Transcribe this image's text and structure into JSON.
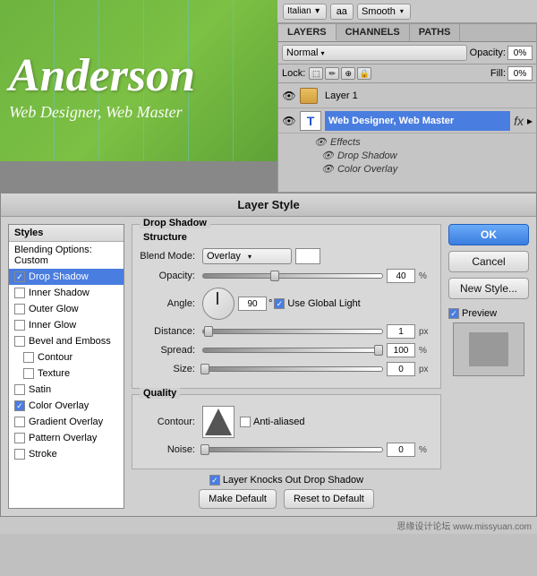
{
  "toolbar": {
    "font_name": "Italian",
    "aa_label": "aa",
    "smooth_label": "Smooth"
  },
  "layers_panel": {
    "tabs": [
      "LAYERS",
      "CHANNELS",
      "PATHS"
    ],
    "active_tab": "LAYERS",
    "blend_mode": "Normal",
    "opacity_label": "Opacity:",
    "opacity_value": "0%",
    "lock_label": "Lock:",
    "fill_label": "Fill:",
    "fill_value": "0%",
    "layer1_name": "Layer 1",
    "layer2_name": "Web Designer, Web Master",
    "effects_label": "Effects",
    "effect1": "Drop Shadow",
    "effect2": "Color Overlay"
  },
  "dialog": {
    "title": "Layer Style",
    "styles_header": "Styles",
    "style_items": [
      {
        "label": "Blending Options: Custom",
        "checked": false,
        "active": false
      },
      {
        "label": "Drop Shadow",
        "checked": true,
        "active": true
      },
      {
        "label": "Inner Shadow",
        "checked": false,
        "active": false
      },
      {
        "label": "Outer Glow",
        "checked": false,
        "active": false
      },
      {
        "label": "Inner Glow",
        "checked": false,
        "active": false
      },
      {
        "label": "Bevel and Emboss",
        "checked": false,
        "active": false
      },
      {
        "label": "Contour",
        "checked": false,
        "active": false,
        "indented": true
      },
      {
        "label": "Texture",
        "checked": false,
        "active": false,
        "indented": true
      },
      {
        "label": "Satin",
        "checked": false,
        "active": false
      },
      {
        "label": "Color Overlay",
        "checked": true,
        "active": false
      },
      {
        "label": "Gradient Overlay",
        "checked": false,
        "active": false
      },
      {
        "label": "Pattern Overlay",
        "checked": false,
        "active": false
      },
      {
        "label": "Stroke",
        "checked": false,
        "active": false
      }
    ],
    "drop_shadow": {
      "section_label": "Drop Shadow",
      "structure_label": "Structure",
      "blend_mode_label": "Blend Mode:",
      "blend_mode_value": "Overlay",
      "opacity_label": "Opacity:",
      "opacity_value": "40",
      "opacity_unit": "%",
      "angle_label": "Angle:",
      "angle_value": "90",
      "use_global_light_label": "Use Global Light",
      "distance_label": "Distance:",
      "distance_value": "1",
      "distance_unit": "px",
      "spread_label": "Spread:",
      "spread_value": "100",
      "spread_unit": "%",
      "size_label": "Size:",
      "size_value": "0",
      "size_unit": "px"
    },
    "quality": {
      "section_label": "Quality",
      "contour_label": "Contour:",
      "anti_aliased_label": "Anti-aliased",
      "noise_label": "Noise:",
      "noise_value": "0",
      "noise_unit": "%"
    },
    "bottom": {
      "layer_knocks_label": "Layer Knocks Out Drop Shadow",
      "make_default_label": "Make Default",
      "reset_label": "Reset to Default"
    },
    "buttons": {
      "ok": "OK",
      "cancel": "Cancel",
      "new_style": "New Style...",
      "preview": "Preview"
    }
  },
  "watermark": "思缘设计论坛 www.missyuan.com"
}
